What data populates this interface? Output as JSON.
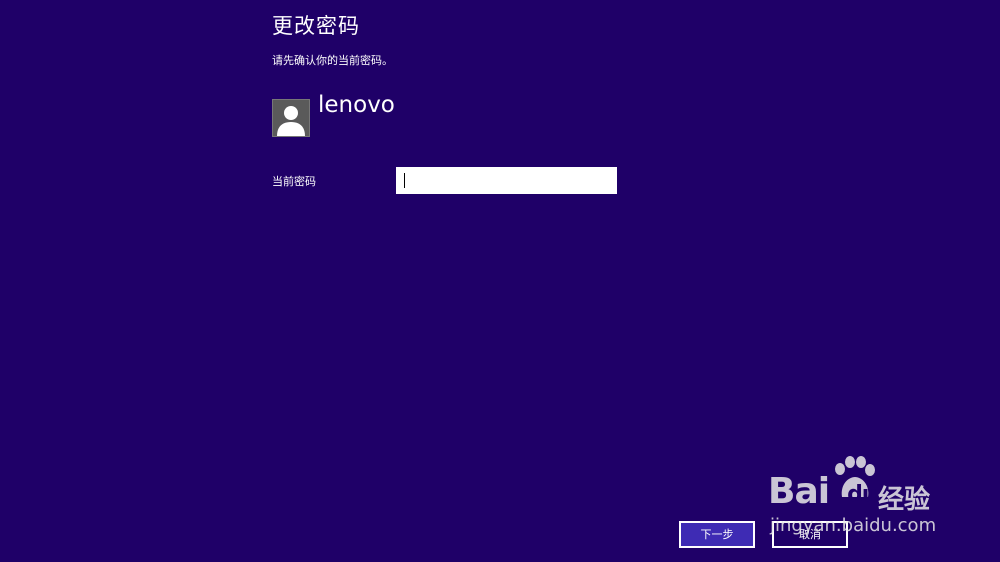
{
  "header": {
    "title": "更改密码",
    "subtitle": "请先确认你的当前密码。"
  },
  "account": {
    "avatar_icon": "user-silhouette-icon",
    "username": "lenovo"
  },
  "form": {
    "current_password_label": "当前密码",
    "current_password_value": ""
  },
  "actions": {
    "next_label": "下一步",
    "cancel_label": "取消"
  },
  "watermark": {
    "brand": "Bai",
    "brand_suffix": "du",
    "product": "经验",
    "domain": "jingyan.baidu.com"
  },
  "colors": {
    "background": "#1f0068",
    "primary_button": "#3e2bb4",
    "text": "#ffffff"
  }
}
